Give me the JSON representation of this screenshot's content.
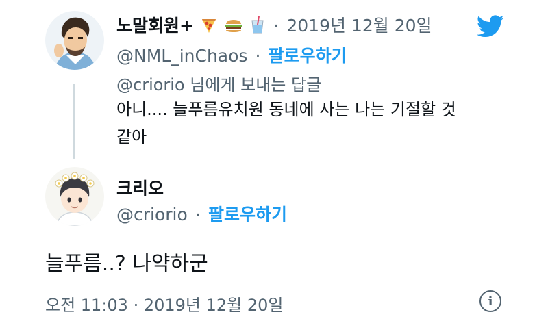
{
  "reply_tweet": {
    "display_name": "노말회원+",
    "emojis": [
      "pizza-icon",
      "burger-icon",
      "drink-icon"
    ],
    "separator": "·",
    "date": "2019년 12월 20일",
    "handle": "@NML_inChaos",
    "follow_label": "팔로우하기",
    "reply_to": "@criorio 님에게 보내는 답글",
    "text_line1": "아니.... 늘푸름유치원 동네에 사는 나는 기절할 것",
    "text_line2": "같아"
  },
  "main_tweet": {
    "display_name": "크리오",
    "handle": "@criorio",
    "separator": "·",
    "follow_label": "팔로우하기",
    "text": "늘푸름..? 나약하군",
    "timestamp": "오전 11:03 · 2019년 12월 20일"
  },
  "icons": {
    "twitter": "twitter-bird-icon",
    "info": "info-icon"
  },
  "colors": {
    "twitter_blue": "#1d9bf0",
    "meta_gray": "#536471",
    "text": "#0f1419"
  }
}
